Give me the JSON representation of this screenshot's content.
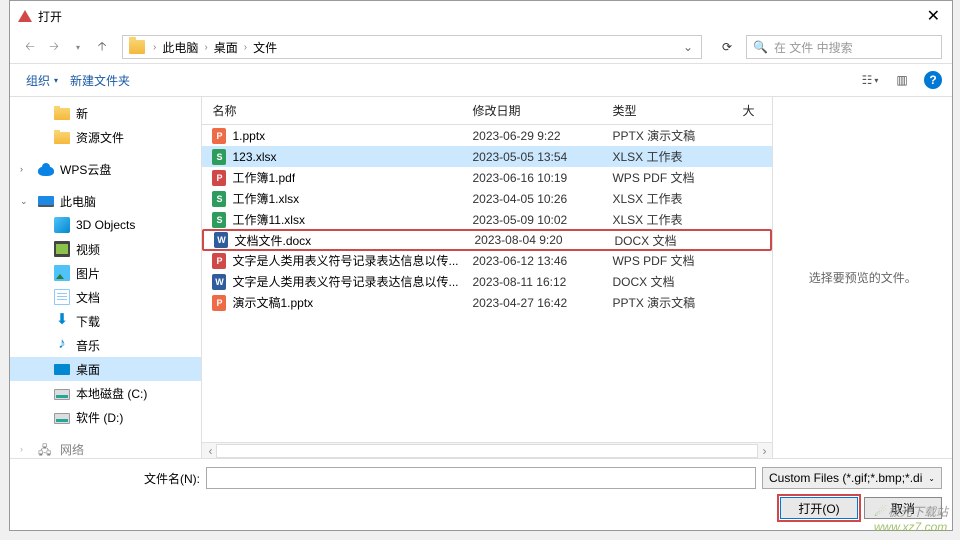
{
  "title": "打开",
  "breadcrumb": {
    "root": "此电脑",
    "p1": "桌面",
    "p2": "文件"
  },
  "search": {
    "placeholder": "在 文件 中搜索"
  },
  "toolbar": {
    "organize": "组织",
    "newfolder": "新建文件夹"
  },
  "sidebar": {
    "new": "新",
    "res": "资源文件",
    "wps": "WPS云盘",
    "pc": "此电脑",
    "threeD": "3D Objects",
    "video": "视频",
    "pic": "图片",
    "doc": "文档",
    "dl": "下载",
    "music": "音乐",
    "desktop": "桌面",
    "diskC": "本地磁盘 (C:)",
    "diskD": "软件 (D:)",
    "net": "网络"
  },
  "columns": {
    "name": "名称",
    "date": "修改日期",
    "type": "类型",
    "size": "大"
  },
  "files": [
    {
      "icon": "p",
      "name": "1.pptx",
      "date": "2023-06-29 9:22",
      "type": "PPTX 演示文稿"
    },
    {
      "icon": "x",
      "name": "123.xlsx",
      "date": "2023-05-05 13:54",
      "type": "XLSX 工作表",
      "selected": true
    },
    {
      "icon": "pdf",
      "name": "工作簿1.pdf",
      "date": "2023-06-16 10:19",
      "type": "WPS PDF 文档"
    },
    {
      "icon": "x",
      "name": "工作簿1.xlsx",
      "date": "2023-04-05 10:26",
      "type": "XLSX 工作表"
    },
    {
      "icon": "x",
      "name": "工作簿11.xlsx",
      "date": "2023-05-09 10:02",
      "type": "XLSX 工作表"
    },
    {
      "icon": "w",
      "name": "文档文件.docx",
      "date": "2023-08-04 9:20",
      "type": "DOCX 文档",
      "highlighted": true
    },
    {
      "icon": "pdf",
      "name": "文字是人类用表义符号记录表达信息以传...",
      "date": "2023-06-12 13:46",
      "type": "WPS PDF 文档"
    },
    {
      "icon": "w",
      "name": "文字是人类用表义符号记录表达信息以传...",
      "date": "2023-08-11 16:12",
      "type": "DOCX 文档"
    },
    {
      "icon": "p",
      "name": "演示文稿1.pptx",
      "date": "2023-04-27 16:42",
      "type": "PPTX 演示文稿"
    }
  ],
  "preview": "选择要预览的文件。",
  "footer": {
    "filename_label": "文件名(N):",
    "filter": "Custom Files (*.gif;*.bmp;*.di",
    "open": "打开(O)",
    "cancel": "取消"
  },
  "watermark": {
    "cn": "极光下载站",
    "url": "www.xz7.com"
  }
}
